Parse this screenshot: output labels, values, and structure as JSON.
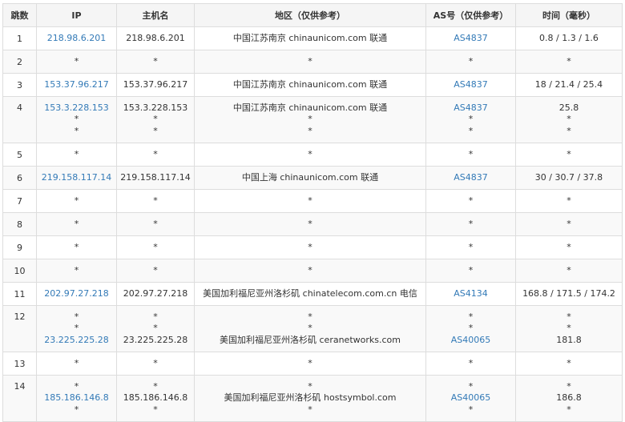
{
  "colors": {
    "link": "#337ab7",
    "text": "#333333",
    "header_bg": "#f5f5f5",
    "stripe_bg": "#f9f9f9",
    "border": "#dddddd"
  },
  "headers": [
    "跳数",
    "IP",
    "主机名",
    "地区（仅供参考）",
    "AS号（仅供参考）",
    "时间（毫秒）"
  ],
  "rows": [
    {
      "hop": "1",
      "ip": [
        "218.98.6.201"
      ],
      "host": [
        "218.98.6.201"
      ],
      "region": [
        "中国江苏南京 chinaunicom.com 联通"
      ],
      "as": [
        "AS4837"
      ],
      "time": [
        "0.8 / 1.3 / 1.6"
      ]
    },
    {
      "hop": "2",
      "ip": [
        "*"
      ],
      "host": [
        "*"
      ],
      "region": [
        "*"
      ],
      "as": [
        "*"
      ],
      "time": [
        "*"
      ]
    },
    {
      "hop": "3",
      "ip": [
        "153.37.96.217"
      ],
      "host": [
        "153.37.96.217"
      ],
      "region": [
        "中国江苏南京 chinaunicom.com 联通"
      ],
      "as": [
        "AS4837"
      ],
      "time": [
        "18 / 21.4 / 25.4"
      ]
    },
    {
      "hop": "4",
      "ip": [
        "153.3.228.153",
        "*",
        "*"
      ],
      "host": [
        "153.3.228.153",
        "*",
        "*"
      ],
      "region": [
        "中国江苏南京 chinaunicom.com 联通",
        "*",
        "*"
      ],
      "as": [
        "AS4837",
        "*",
        "*"
      ],
      "time": [
        "25.8",
        "*",
        "*"
      ]
    },
    {
      "hop": "5",
      "ip": [
        "*"
      ],
      "host": [
        "*"
      ],
      "region": [
        "*"
      ],
      "as": [
        "*"
      ],
      "time": [
        "*"
      ]
    },
    {
      "hop": "6",
      "ip": [
        "219.158.117.14"
      ],
      "host": [
        "219.158.117.14"
      ],
      "region": [
        "中国上海 chinaunicom.com 联通"
      ],
      "as": [
        "AS4837"
      ],
      "time": [
        "30 / 30.7 / 37.8"
      ]
    },
    {
      "hop": "7",
      "ip": [
        "*"
      ],
      "host": [
        "*"
      ],
      "region": [
        "*"
      ],
      "as": [
        "*"
      ],
      "time": [
        "*"
      ]
    },
    {
      "hop": "8",
      "ip": [
        "*"
      ],
      "host": [
        "*"
      ],
      "region": [
        "*"
      ],
      "as": [
        "*"
      ],
      "time": [
        "*"
      ]
    },
    {
      "hop": "9",
      "ip": [
        "*"
      ],
      "host": [
        "*"
      ],
      "region": [
        "*"
      ],
      "as": [
        "*"
      ],
      "time": [
        "*"
      ]
    },
    {
      "hop": "10",
      "ip": [
        "*"
      ],
      "host": [
        "*"
      ],
      "region": [
        "*"
      ],
      "as": [
        "*"
      ],
      "time": [
        "*"
      ]
    },
    {
      "hop": "11",
      "ip": [
        "202.97.27.218"
      ],
      "host": [
        "202.97.27.218"
      ],
      "region": [
        "美国加利福尼亚州洛杉矶 chinatelecom.com.cn 电信"
      ],
      "as": [
        "AS4134"
      ],
      "time": [
        "168.8 / 171.5 / 174.2"
      ]
    },
    {
      "hop": "12",
      "ip": [
        "*",
        "*",
        "23.225.225.28"
      ],
      "host": [
        "*",
        "*",
        "23.225.225.28"
      ],
      "region": [
        "*",
        "*",
        "美国加利福尼亚州洛杉矶 ceranetworks.com"
      ],
      "as": [
        "*",
        "*",
        "AS40065"
      ],
      "time": [
        "*",
        "*",
        "181.8"
      ]
    },
    {
      "hop": "13",
      "ip": [
        "*"
      ],
      "host": [
        "*"
      ],
      "region": [
        "*"
      ],
      "as": [
        "*"
      ],
      "time": [
        "*"
      ]
    },
    {
      "hop": "14",
      "ip": [
        "*",
        "185.186.146.8",
        "*"
      ],
      "host": [
        "*",
        "185.186.146.8",
        "*"
      ],
      "region": [
        "*",
        "美国加利福尼亚州洛杉矶 hostsymbol.com",
        "*"
      ],
      "as": [
        "*",
        "AS40065",
        "*"
      ],
      "time": [
        "*",
        "186.8",
        "*"
      ]
    }
  ]
}
